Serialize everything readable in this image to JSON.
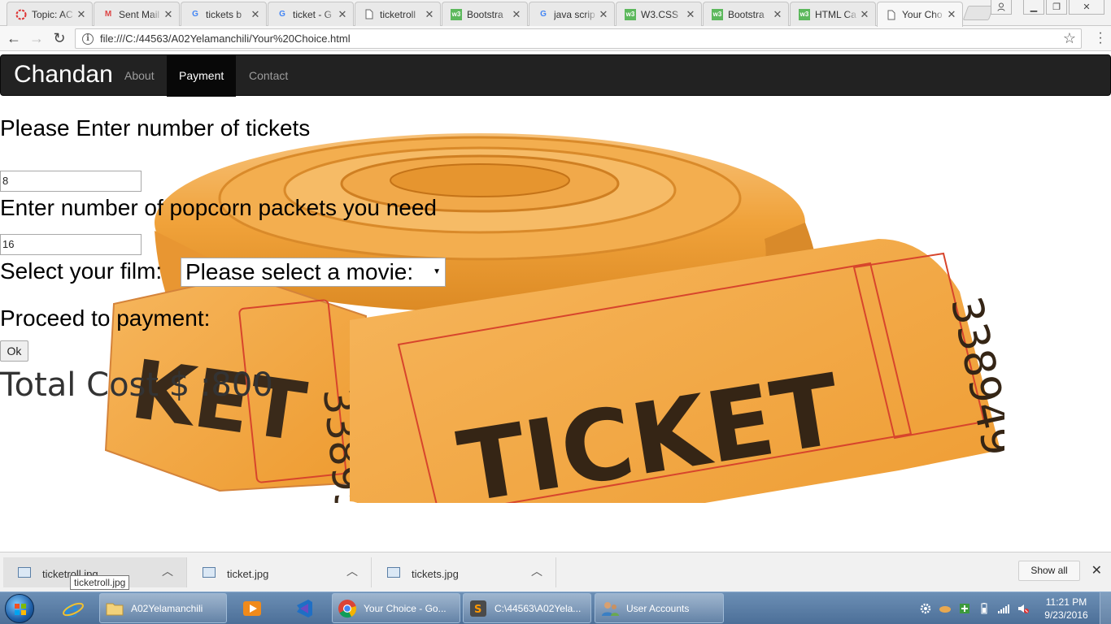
{
  "browser": {
    "tabs": [
      {
        "title": "Topic: AC",
        "favicon": "red-circle-icon"
      },
      {
        "title": "Sent Mail",
        "favicon": "gmail-icon"
      },
      {
        "title": "tickets b",
        "favicon": "google-icon"
      },
      {
        "title": "ticket - G",
        "favicon": "google-icon"
      },
      {
        "title": "ticketroll",
        "favicon": "file-icon"
      },
      {
        "title": "Bootstra",
        "favicon": "w3schools-icon"
      },
      {
        "title": "java scrip",
        "favicon": "google-icon"
      },
      {
        "title": "W3.CSS",
        "favicon": "w3schools-icon"
      },
      {
        "title": "Bootstra",
        "favicon": "w3schools-icon"
      },
      {
        "title": "HTML Ca",
        "favicon": "w3schools-icon"
      },
      {
        "title": "Your Cho",
        "favicon": "file-icon",
        "active": true
      }
    ],
    "url": "file:///C:/44563/A02Yelamanchili/Your%20Choice.html"
  },
  "page": {
    "navbar": {
      "brand": "Chandan",
      "links": [
        {
          "label": "About",
          "active": false
        },
        {
          "label": "Payment",
          "active": true
        },
        {
          "label": "Contact",
          "active": false
        }
      ]
    },
    "tickets_label": "Please Enter number of tickets",
    "tickets_value": "8",
    "popcorn_label": "Enter number of popcorn packets you need",
    "popcorn_value": "16",
    "film_label": "Select your film:",
    "film_select": "Please select a movie:",
    "proceed_label": "Proceed to payment:",
    "ok_button": "Ok",
    "total_cost": "Total Cost $ :800",
    "illustration": {
      "ticket_text": "TICKET",
      "number_front": "338949",
      "number_back": "338950"
    }
  },
  "downloads": {
    "items": [
      "ticketroll.jpg",
      "ticket.jpg",
      "tickets.jpg"
    ],
    "tooltip": "ticketroll.jpg",
    "show_all": "Show all"
  },
  "taskbar": {
    "tasks": [
      {
        "label": "A02Yelamanchili",
        "icon": "folder-icon"
      },
      {
        "label": "Your Choice - Go...",
        "icon": "chrome-icon"
      },
      {
        "label": "C:\\44563\\A02Yela...",
        "icon": "sublime-icon"
      },
      {
        "label": "User Accounts",
        "icon": "users-icon"
      }
    ],
    "time": "11:21 PM",
    "date": "9/23/2016"
  },
  "colors": {
    "navbar_bg": "#222222",
    "ticket_orange": "#f0a23a",
    "taskbar": "#5a7ea6"
  }
}
